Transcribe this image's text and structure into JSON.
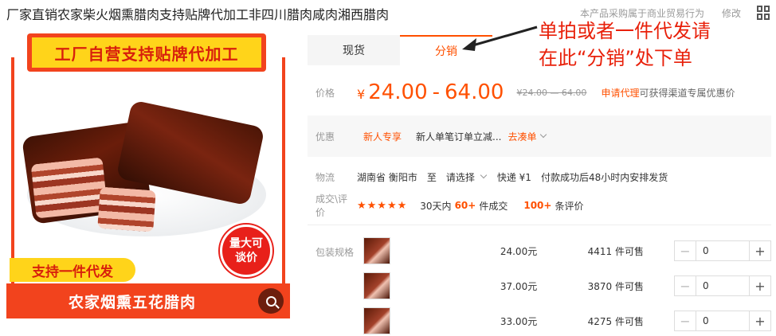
{
  "header": {
    "title": "厂家直销农家柴火烟熏腊肉支持贴牌代加工非四川腊肉咸肉湘西腊肉",
    "notice": "本产品采购属于商业贸易行为",
    "edit": "修改"
  },
  "image": {
    "top_banner": "工厂自营支持贴牌代加工",
    "seal_line1": "量大可",
    "seal_line2": "谈价",
    "side_tag": "支持一件代发",
    "bottom_banner": "农家烟熏五花腊肉"
  },
  "tabs": [
    {
      "label": "现货",
      "active": false
    },
    {
      "label": "分销",
      "active": true
    }
  ],
  "callout": {
    "line1": "单拍或者一件代发请",
    "line2": "在此“分销”处下单"
  },
  "price": {
    "label": "价格",
    "currency": "¥",
    "low": "24.00",
    "high": "64.00",
    "sep": "-",
    "original": "¥24.00 — 64.00",
    "agent_link": "申请代理",
    "agent_desc": "可获得渠道专属优惠价"
  },
  "promo": {
    "label": "优惠",
    "badge": "新人专享",
    "text": "新人单笔订单立减...",
    "link": "去凑单"
  },
  "shipping": {
    "label": "物流",
    "origin": "湖南省 衡阳市",
    "to": "至",
    "destination": "请选择",
    "express": "快递 ¥1",
    "dispatch": "付款成功后48小时内安排发货"
  },
  "rating": {
    "label": "成交\\评价",
    "stars": "★★★★★",
    "prefix": "30天内",
    "count": "60+",
    "count_suffix": "件成交",
    "reviews": "100+",
    "reviews_suffix": "条评价"
  },
  "sku": {
    "label": "包装规格",
    "items": [
      {
        "price": "24.00元",
        "stock": "4411 件可售",
        "qty": "0"
      },
      {
        "price": "37.00元",
        "stock": "3870 件可售",
        "qty": "0"
      },
      {
        "price": "33.00元",
        "stock": "4275 件可售",
        "qty": "0"
      }
    ]
  },
  "colors": {
    "accent": "#ff5000",
    "banner_red": "#f2431d",
    "banner_yellow": "#ffd41a"
  }
}
